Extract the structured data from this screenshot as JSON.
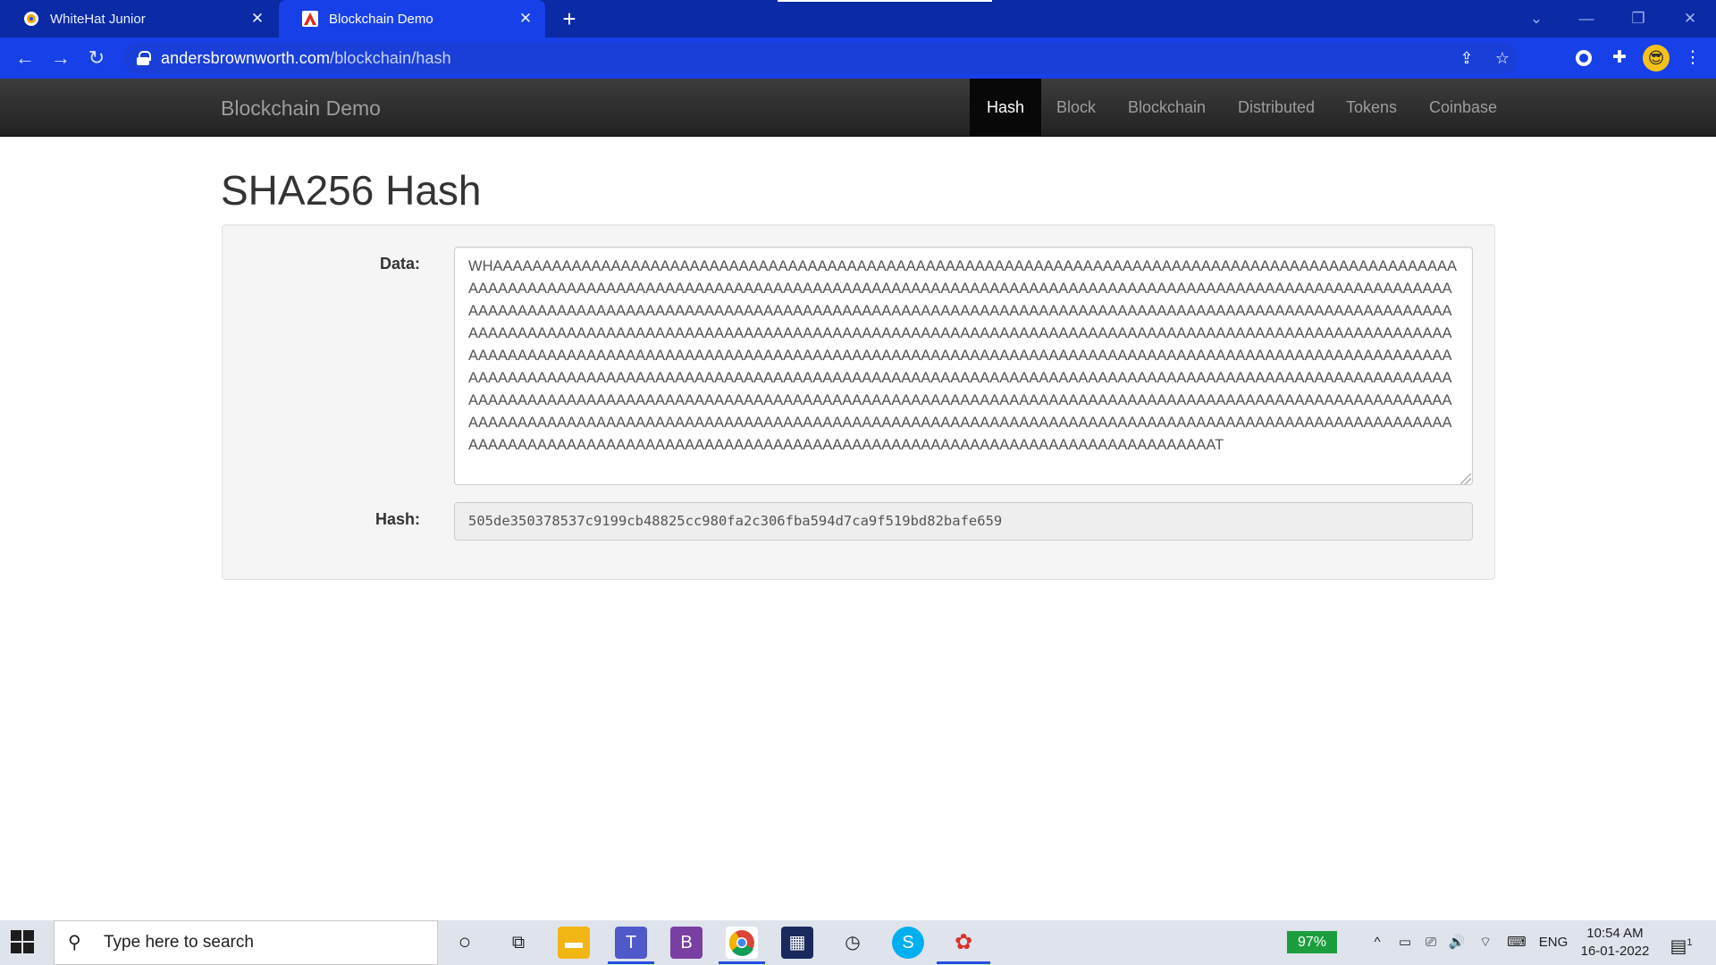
{
  "browser": {
    "tabs": [
      {
        "title": "WhiteHat Junior",
        "active": false
      },
      {
        "title": "Blockchain Demo",
        "active": true
      }
    ],
    "url_host": "andersbrownworth.com",
    "url_path": "/blockchain/hash"
  },
  "navbar": {
    "brand": "Blockchain Demo",
    "links": [
      "Hash",
      "Block",
      "Blockchain",
      "Distributed",
      "Tokens",
      "Coinbase"
    ],
    "active_link": "Hash"
  },
  "main": {
    "title": "SHA256 Hash",
    "data_label": "Data:",
    "data_value": "WHAAAAAAAAAAAAAAAAAAAAAAAAAAAAAAAAAAAAAAAAAAAAAAAAAAAAAAAAAAAAAAAAAAAAAAAAAAAAAAAAAAAAAAAAAAAAAAAAAAAAAAAAAAAAAAAAAAAAAAAAAAAAAAAAAAAAAAAAAAAAAAAAAAAAAAAAAAAAAAAAAAAAAAAAAAAAAAAAAAAAAAAAAAAAAAAAAAAAAAAAAAAAAAAAAAAAAAAAAAAAAAAAAAAAAAAAAAAAAAAAAAAAAAAAAAAAAAAAAAAAAAAAAAAAAAAAAAAAAAAAAAAAAAAAAAAAAAAAAAAAAAAAAAAAAAAAAAAAAAAAAAAAAAAAAAAAAAAAAAAAAAAAAAAAAAAAAAAAAAAAAAAAAAAAAAAAAAAAAAAAAAAAAAAAAAAAAAAAAAAAAAAAAAAAAAAAAAAAAAAAAAAAAAAAAAAAAAAAAAAAAAAAAAAAAAAAAAAAAAAAAAAAAAAAAAAAAAAAAAAAAAAAAAAAAAAAAAAAAAAAAAAAAAAAAAAAAAAAAAAAAAAAAAAAAAAAAAAAAAAAAAAAAAAAAAAAAAAAAAAAAAAAAAAAAAAAAAAAAAAAAAAAAAAAAAAAAAAAAAAAAAAAAAAAAAAAAAAAAAAAAAAAAAAAAAAAAAAAAAAAAAAAAAAAAAAAAAAAAAAAAAAAAAAAAAAAAAAAAAAAAAAAAAAAAAAAAAAAAAAAAAAAAAAAAAAAAAAAAAAAAAAAAAAAAAAAAAAAAAAAAAAAAAAAAAAAAAAAAAAAAAAAAAAAAAAAAAAAAAAAAAAAAAAAAAAAAAAAAAAAAAAAAAAAAAAAAAAAAAAAAAAAAAAAAAAAAAAAAAAAAAAAAAAAAAAAAAAAAAAAAAAAAAAAAAAAAAT",
    "hash_label": "Hash:",
    "hash_value": "505de350378537c9199cb48825cc980fa2c306fba594d7ca9f519bd82bafe659"
  },
  "taskbar": {
    "search_placeholder": "Type here to search",
    "battery": "97%",
    "language": "ENG",
    "time": "10:54 AM",
    "date": "16-01-2022",
    "notifications": "1"
  },
  "colors": {
    "browser_tabbar": "#0b2aa5",
    "browser_toolbar": "#1740e8",
    "navbar": "#222222",
    "navbar_active": "#080808",
    "battery_green": "#1c9e3f"
  },
  "icons": [
    "whitehat-favicon",
    "blockchain-favicon",
    "close-icon",
    "plus-icon",
    "back-arrow-icon",
    "forward-arrow-icon",
    "reload-icon",
    "lock-icon",
    "share-icon",
    "star-icon",
    "extension-icon",
    "puzzle-icon",
    "avatar-icon",
    "kebab-menu-icon",
    "windows-start-icon",
    "search-icon",
    "cortana-icon",
    "task-view-icon",
    "file-explorer-icon",
    "teams-icon",
    "bootstrap-studio-icon",
    "chrome-icon",
    "media-icon",
    "clock-app-icon",
    "skype-icon",
    "paint-app-icon",
    "chevron-up-icon",
    "network-icon",
    "volume-icon",
    "wifi-icon",
    "keyboard-icon",
    "notification-icon"
  ]
}
